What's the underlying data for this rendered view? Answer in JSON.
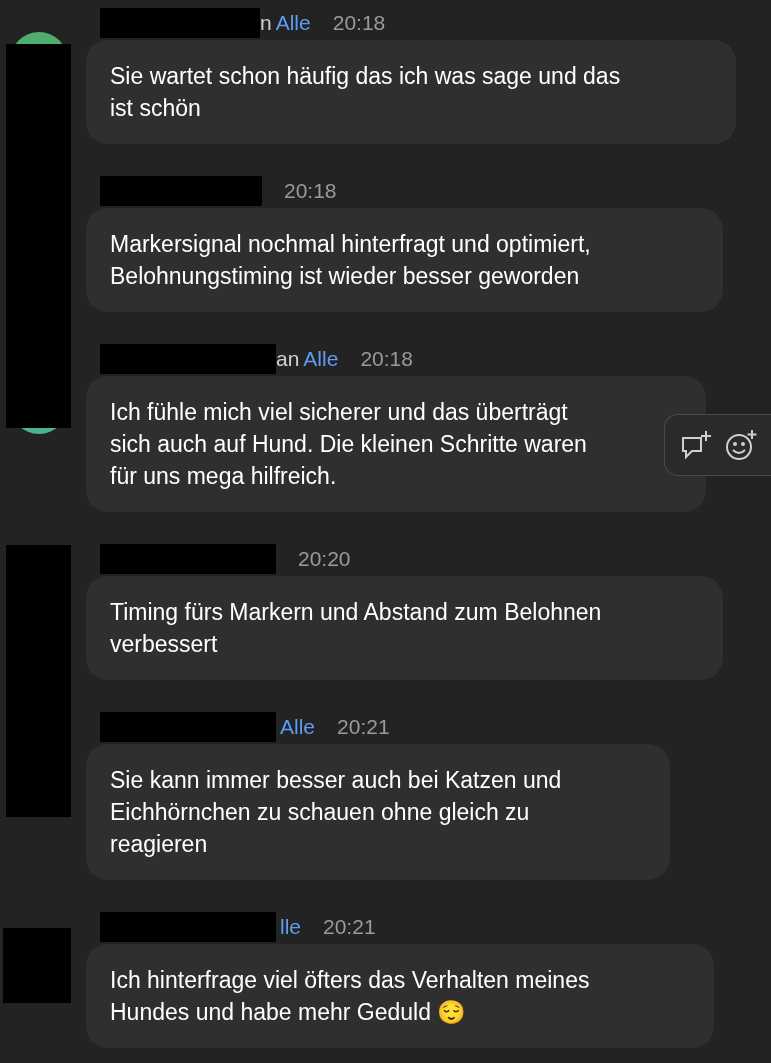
{
  "messages": [
    {
      "prefix": "n",
      "recipient": "Alle",
      "time": "20:18",
      "text": "Sie wartet schon häufig das ich was sage und das ist schön",
      "avatar": {
        "color": "#4fae6e"
      },
      "hovered": false
    },
    {
      "time": "20:18",
      "text": "Markersignal nochmal hinterfragt und optimiert, Belohnungstiming ist wieder besser geworden",
      "hovered": false
    },
    {
      "prefix": "an",
      "recipient": "Alle",
      "time": "20:18",
      "text": "Ich fühle mich viel sicherer und das überträgt sich auch auf Hund. Die kleinen Schritte waren für uns mega hilfreich.",
      "avatar": {
        "color": "#4bb395"
      },
      "hovered": true
    },
    {
      "time": "20:20",
      "text": "Timing fürs Markern und Abstand zum Belohnen verbessert",
      "hovered": false
    },
    {
      "recipient": "Alle",
      "time": "20:21",
      "text": "Sie kann immer besser auch bei Katzen und Eichhörnchen zu schauen ohne gleich zu reagieren",
      "hovered": false
    },
    {
      "recipient": "lle",
      "time": "20:21",
      "text": "Ich hinterfrage viel öfters das Verhalten meines Hundes und habe mehr Geduld 😌",
      "hovered": false
    }
  ]
}
